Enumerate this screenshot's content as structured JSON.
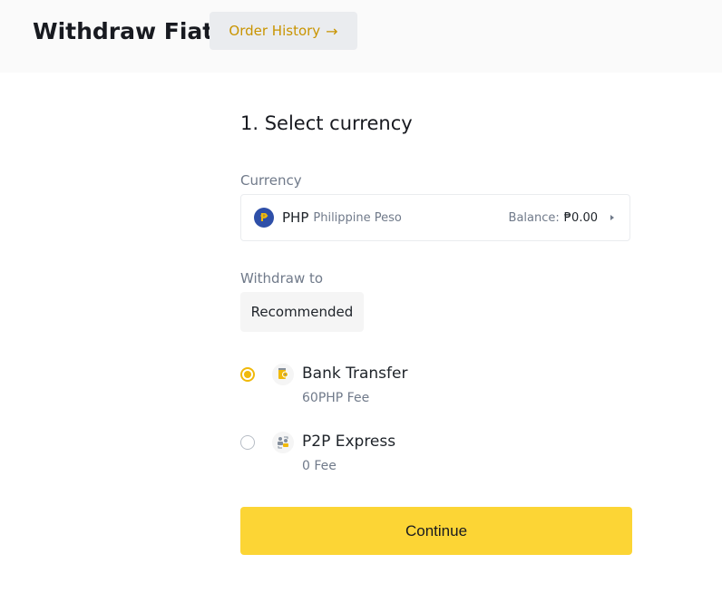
{
  "header": {
    "title": "Withdraw Fiat",
    "order_history_label": "Order History",
    "order_history_icon": "arrow-right-icon"
  },
  "step": {
    "title": "1. Select currency"
  },
  "currency": {
    "label": "Currency",
    "icon": "peso-coin-icon",
    "icon_glyph": "₱",
    "code": "PHP",
    "name": "Philippine Peso",
    "balance_label": "Balance:",
    "balance_value": "₱0.00"
  },
  "withdraw_to": {
    "label": "Withdraw to",
    "tab_label": "Recommended",
    "methods": [
      {
        "title": "Bank Transfer",
        "fee": "60PHP Fee",
        "selected": true,
        "icon": "bank-card-icon"
      },
      {
        "title": "P2P Express",
        "fee": "0 Fee",
        "selected": false,
        "icon": "p2p-users-icon"
      }
    ]
  },
  "actions": {
    "continue_label": "Continue"
  },
  "colors": {
    "accent": "#f0b90b",
    "button": "#fcd535",
    "link": "#c99400"
  }
}
